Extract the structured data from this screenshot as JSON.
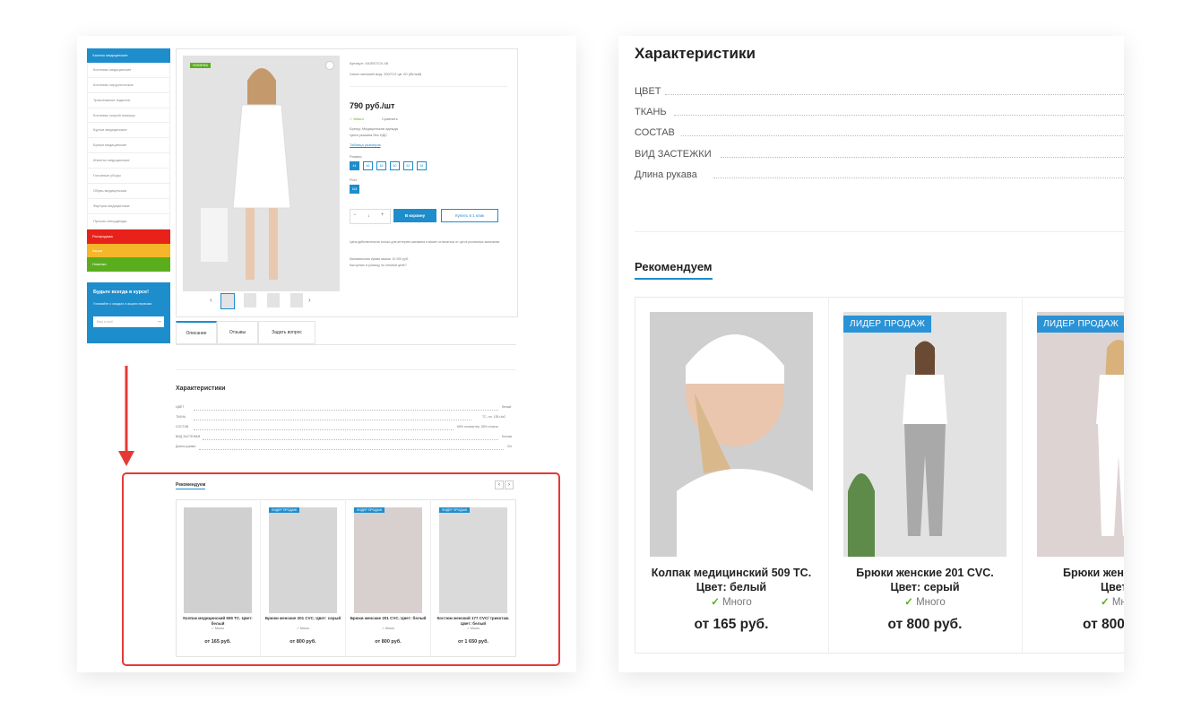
{
  "left_page": {
    "sidebar": {
      "head": "Халаты медицинские",
      "items": [
        "Костюмы медицинские",
        "Костюмы хирургические",
        "Трикотажные изделия",
        "Костюмы скорой помощи",
        "Куртки медицинские",
        "Брюки медицинские",
        "Жилеты медицинские",
        "Головные уборы",
        "Обувь медицинская",
        "Фартуки медицинские",
        "Прочая спецодежда"
      ],
      "promo_items": [
        "Распродажа",
        "Акции",
        "Новинки"
      ],
      "subscribe": {
        "title": "Будьте всегда в курсе!",
        "text": "Узнавайте о скидках и акциях первыми",
        "placeholder": "Ваш e-mail",
        "arrow": "→"
      }
    },
    "product": {
      "badge": "НОВИНКА",
      "article": "Артикул: ХАЛ007СХ-48",
      "name": "Халат женский мод. 2007СХ цв. 00 (белый)",
      "price": "790 руб./шт",
      "stock": "✓ Много",
      "compare": "Сравнить",
      "note1": "Бренд: Медицинская одежда",
      "note2": "Цена указана без НДС",
      "size_table": "Таблица размеров",
      "size_label": "Размер",
      "sizes": [
        "44",
        "46",
        "48",
        "50",
        "52",
        "54"
      ],
      "height_label": "Рост",
      "height": "164",
      "qty_minus": "−",
      "qty": "1",
      "qty_plus": "+",
      "cart_button": "В корзину",
      "one_click_button": "Купить в 1 клик",
      "info1": "Цена действительна только для интернет-магазина и может отличаться от цен в розничных магазинах",
      "info2": "Минимальная сумма заказа: 10 000 руб.",
      "info3": "Как купить в розницу по оптовой цене?",
      "gallery_prev": "‹",
      "gallery_next": "›"
    },
    "tabs": [
      "Описание",
      "Отзывы",
      "Задать вопрос"
    ],
    "characteristics": {
      "title": "Характеристики",
      "rows": [
        {
          "label": "ЦВЕТ",
          "value": "белый"
        },
        {
          "label": "ТКАНЬ",
          "value": "ТС, пл. 135 г/м2"
        },
        {
          "label": "СОСТАВ",
          "value": "65% полиэстер, 35% хлопок"
        },
        {
          "label": "ВИД ЗАСТЕЖКИ",
          "value": "Кнопки"
        },
        {
          "label": "Длина рукава",
          "value": "3/4"
        }
      ]
    },
    "recommend": {
      "title": "Рекомендуем",
      "prev": "‹",
      "next": "›",
      "items": [
        {
          "badge": "",
          "title": "Колпак медицинский 509 ТС. Цвет: белый",
          "stock": "✓ Много",
          "price": "от 165 руб."
        },
        {
          "badge": "ЛИДЕР ПРОДАЖ",
          "title": "Брюки женские 201 CVC. Цвет: серый",
          "stock": "✓ Много",
          "price": "от 800 руб."
        },
        {
          "badge": "ЛИДЕР ПРОДАЖ",
          "title": "Брюки женские 201 CVC. Цвет: белый",
          "stock": "✓ Много",
          "price": "от 800 руб."
        },
        {
          "badge": "ЛИДЕР ПРОДАЖ",
          "title": "Костюм женский 177 CVC/ трикотаж. Цвет: белый",
          "stock": "✓ Много",
          "price": "от 1 650 руб."
        }
      ]
    }
  },
  "right_page": {
    "characteristics_title": "Характеристики",
    "char_rows": [
      "ЦВЕТ",
      "ТКАНЬ",
      "СОСТАВ",
      "ВИД ЗАСТЕЖКИ",
      "Длина рукава"
    ],
    "recommend_title": "Рекомендуем",
    "cards": [
      {
        "badge": "",
        "title_line1": "Колпак медицинский 509 ТС.",
        "title_line2": "Цвет: белый",
        "stock": "Много",
        "price": "от 165 руб."
      },
      {
        "badge": "ЛИДЕР ПРОДАЖ",
        "title_line1": "Брюки женские 201 CVC.",
        "title_line2": "Цвет: серый",
        "stock": "Много",
        "price": "от 800 руб."
      },
      {
        "badge": "ЛИДЕР ПРОДАЖ",
        "title_line1": "Брюки женск",
        "title_line2": "Цвет: б",
        "stock": "Мн",
        "price": "от 800"
      }
    ]
  },
  "colors": {
    "accent": "#1e8dcc",
    "highlight_red": "#e53935",
    "stock_green": "#5aae1e"
  }
}
